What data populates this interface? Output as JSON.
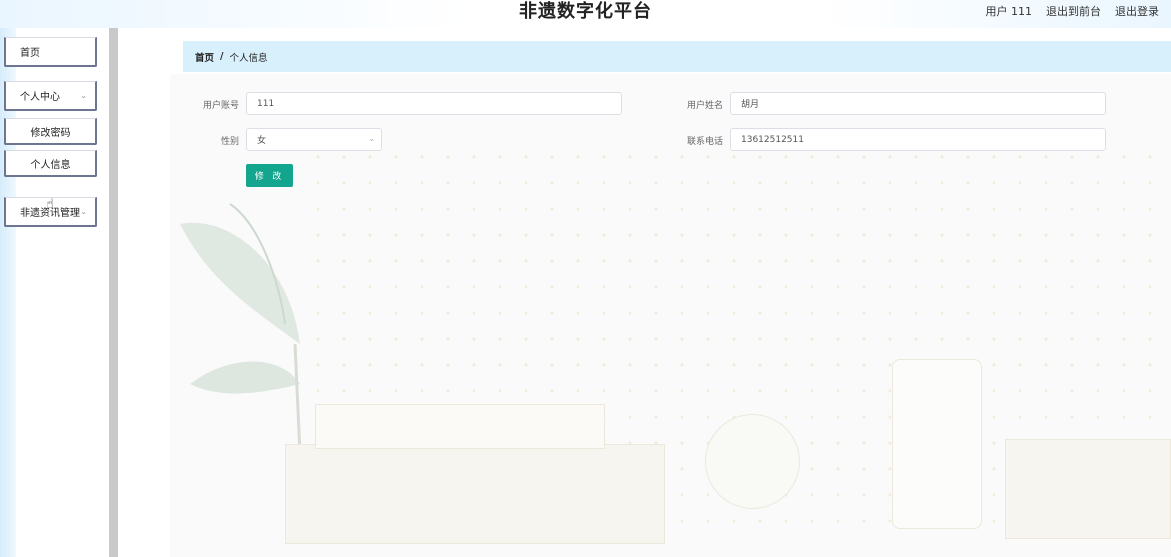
{
  "app": {
    "title": "非遗数字化平台"
  },
  "header": {
    "user_label": "用户 111",
    "front_label": "退出到前台",
    "logout_label": "退出登录"
  },
  "sidebar": {
    "items": [
      {
        "label": "首页"
      },
      {
        "label": "个人中心"
      },
      {
        "label": "修改密码"
      },
      {
        "label": "个人信息"
      },
      {
        "label": "非遗资讯管理"
      }
    ]
  },
  "breadcrumb": {
    "home": "首页",
    "separator": "/",
    "current": "个人信息"
  },
  "form": {
    "username_label": "用户账号",
    "username_value": "111",
    "realname_label": "用户姓名",
    "realname_value": "胡月",
    "gender_label": "性别",
    "gender_value": "女",
    "phone_label": "联系电话",
    "phone_value": "13612512511",
    "submit_label": "修 改"
  },
  "icons": {
    "chevron": "chevron-down-icon",
    "pointer": "hand-pointer-icon"
  },
  "colors": {
    "accent": "#13a58e",
    "breadcrumb_bg": "#d8f0fc",
    "nav_border": "#6d7591"
  }
}
